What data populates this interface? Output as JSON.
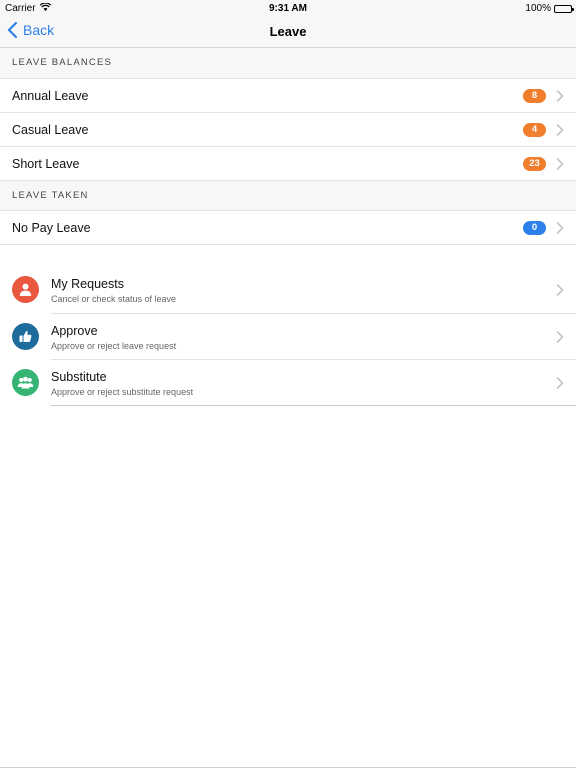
{
  "status_bar": {
    "carrier": "Carrier",
    "time": "9:31 AM",
    "battery": "100%"
  },
  "nav": {
    "back_label": "Back",
    "title": "Leave"
  },
  "leave_balances": {
    "header": "LEAVE BALANCES",
    "items": [
      {
        "label": "Annual Leave",
        "count": "8"
      },
      {
        "label": "Casual Leave",
        "count": "4"
      },
      {
        "label": "Short Leave",
        "count": "23"
      }
    ]
  },
  "leave_taken": {
    "header": "LEAVE TAKEN",
    "items": [
      {
        "label": "No Pay Leave",
        "count": "0"
      }
    ]
  },
  "menu": [
    {
      "title": "My Requests",
      "subtitle": "Cancel or check status of leave",
      "icon": "person-icon"
    },
    {
      "title": "Approve",
      "subtitle": "Approve or reject leave request",
      "icon": "thumbs-up-icon"
    },
    {
      "title": "Substitute",
      "subtitle": "Approve or reject substitute request",
      "icon": "group-icon"
    }
  ],
  "colors": {
    "accent_blue": "#2f7fe6",
    "badge_orange": "#f07e2d",
    "badge_blue": "#2e80eb",
    "icon_red": "#e9573f",
    "icon_blue": "#1d6c9c",
    "icon_green": "#35b473"
  }
}
